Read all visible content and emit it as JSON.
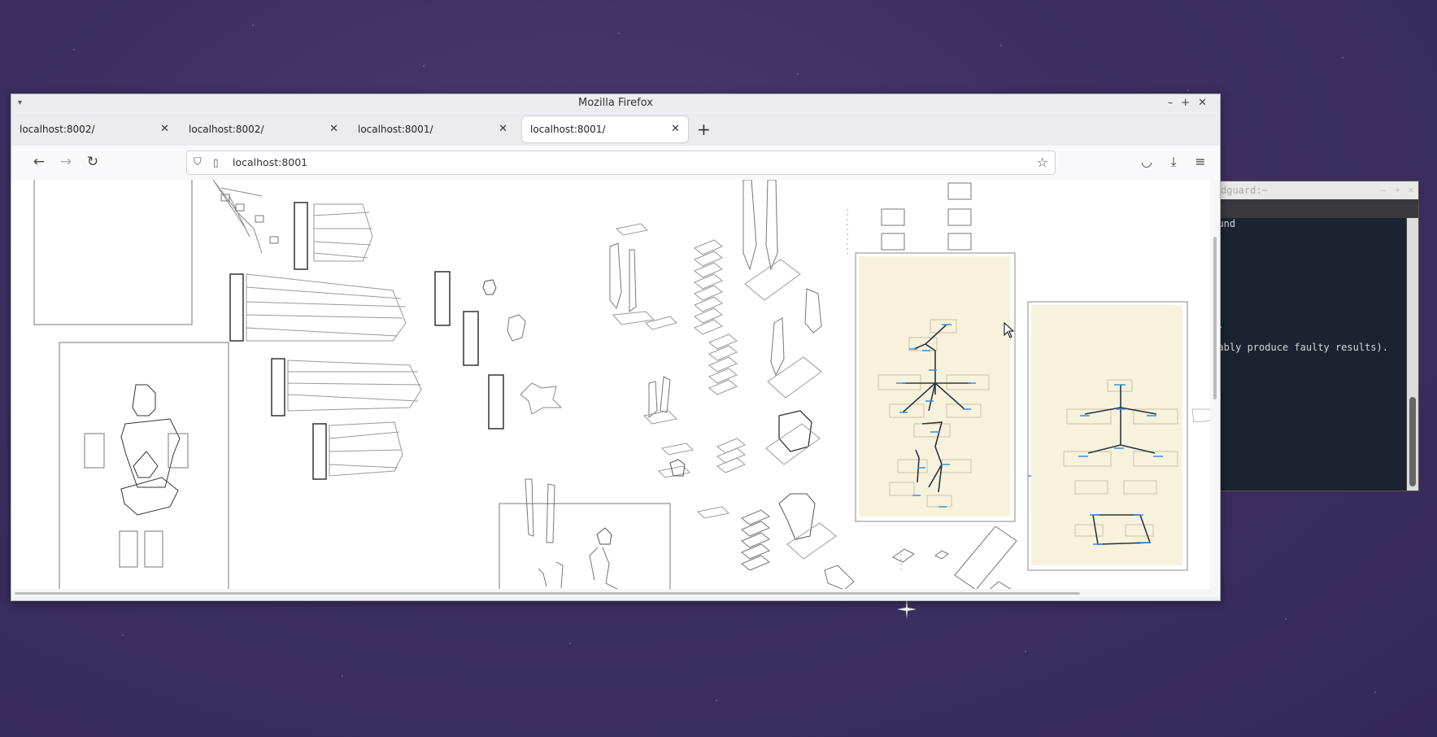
{
  "window": {
    "title": "Mozilla Firefox"
  },
  "tabs": [
    {
      "label": "localhost:8002/",
      "active": false
    },
    {
      "label": "localhost:8002/",
      "active": false
    },
    {
      "label": "localhost:8001/",
      "active": false
    },
    {
      "label": "localhost:8001/",
      "active": true
    }
  ],
  "toolbar": {
    "url": "localhost:8001",
    "new_tab_label": "+",
    "back_icon": "←",
    "forward_icon": "→",
    "reload_icon": "↻"
  },
  "terminal": {
    "title": "dguard:~",
    "lines": [
      "sound",
      "me.",
      "obably produce faulty results)."
    ]
  },
  "colors": {
    "panel_fill": "#f6f2dc",
    "bone_stroke": "#2b3440",
    "joint_accent": "#3b8fd6",
    "sketch_stroke": "#6a6a6a"
  }
}
